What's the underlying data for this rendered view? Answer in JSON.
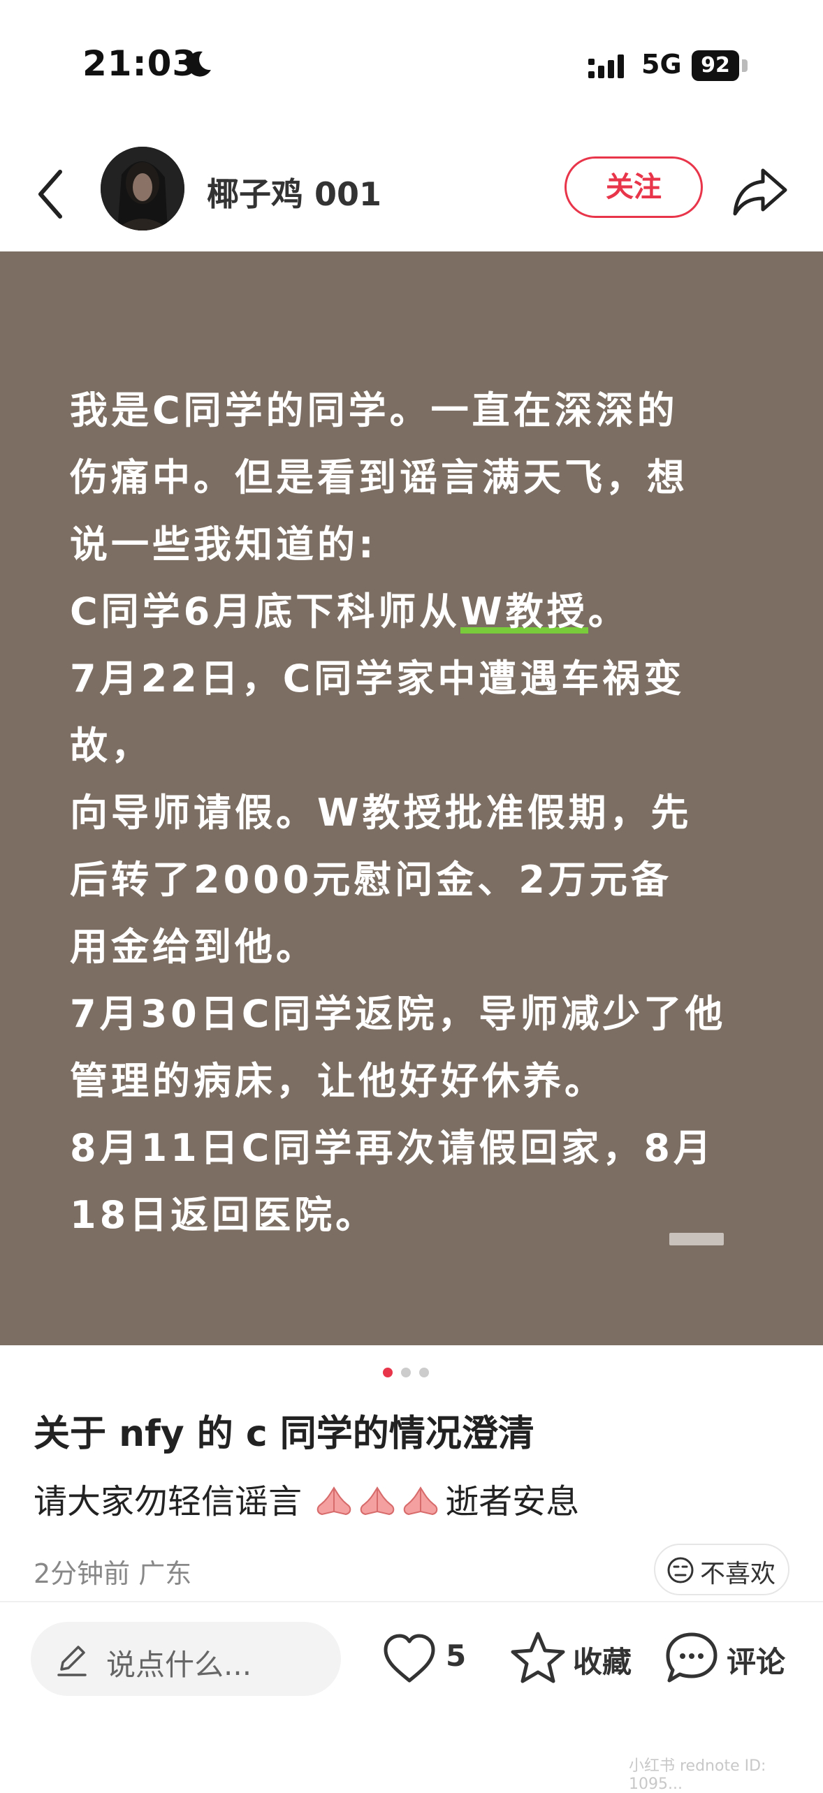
{
  "status_bar": {
    "time": "21:03",
    "network": "5G",
    "battery": "92"
  },
  "header": {
    "author": "椰子鸡 001",
    "follow_label": "关注"
  },
  "post": {
    "lines": [
      "我是C同学的同学。一直在深深的",
      "伤痛中。但是看到谣言满天飞，想",
      "说一些我知道的:",
      "C同学6月底下科师从",
      "W教授",
      "。",
      "7月22日，C同学家中遭遇车祸变故，",
      "向导师请假。W教授批准假期，先",
      "后转了2000元慰问金、2万元备",
      "用金给到他。",
      "7月30日C同学返院，导师减少了他",
      "管理的病床，让他好好休养。",
      "8月11日C同学再次请假回家，8月",
      "18日返回医院。"
    ],
    "title": "关于 nfy 的 c 同学的情况澄清",
    "description": "请大家勿轻信谣言",
    "description_tail": "逝者安息",
    "meta": "2分钟前  广东",
    "dislike_label": "不喜欢",
    "image_page": {
      "current": 1,
      "total": 3
    }
  },
  "bottom_bar": {
    "comment_placeholder": "说点什么...",
    "like_count": "5",
    "collect_label": "收藏",
    "comment_label": "评论"
  },
  "watermark": "小红书  rednote ID: 1095...",
  "colors": {
    "accent": "#e8354a",
    "image_bg": "#7c6e62",
    "highlight": "#7acb3c"
  }
}
